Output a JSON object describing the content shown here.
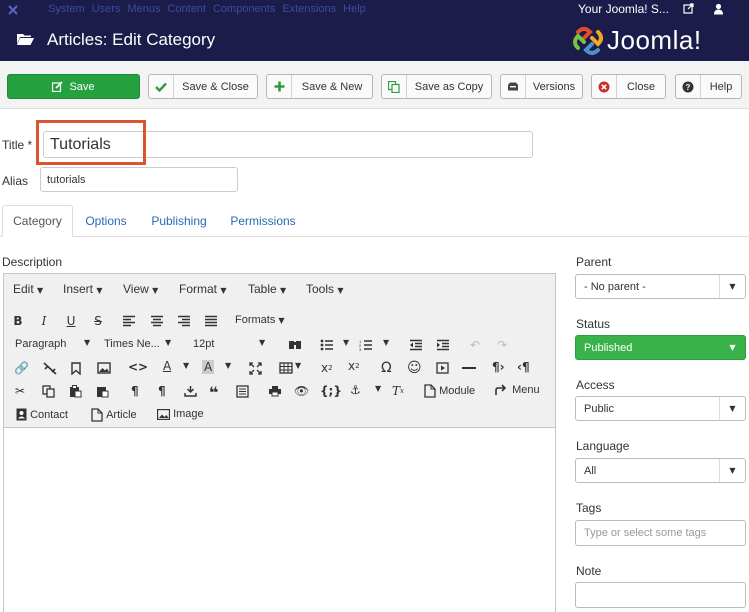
{
  "topnav": {
    "menu": [
      "System",
      "Users",
      "Menus",
      "Content",
      "Components",
      "Extensions",
      "Help"
    ],
    "site_name": "Your Joomla! S..."
  },
  "header": {
    "title": "Articles: Edit Category",
    "brand": "Joomla!"
  },
  "toolbar": {
    "save": "Save",
    "save_close": "Save & Close",
    "save_new": "Save & New",
    "save_copy": "Save as Copy",
    "versions": "Versions",
    "close": "Close",
    "help": "Help"
  },
  "form": {
    "title_label": "Title *",
    "title_value": "Tutorials",
    "alias_label": "Alias",
    "alias_value": "tutorials"
  },
  "tabs": [
    "Category",
    "Options",
    "Publishing",
    "Permissions"
  ],
  "editor": {
    "description_label": "Description",
    "menus": [
      "Edit",
      "Insert",
      "View",
      "Format",
      "Table",
      "Tools"
    ],
    "formats": "Formats",
    "paragraph": "Paragraph",
    "font": "Times Ne...",
    "size": "12pt",
    "module": "Module",
    "menu": "Menu",
    "contact": "Contact",
    "article": "Article",
    "image": "Image"
  },
  "sidebar": {
    "parent_label": "Parent",
    "parent_value": "- No parent -",
    "status_label": "Status",
    "status_value": "Published",
    "access_label": "Access",
    "access_value": "Public",
    "language_label": "Language",
    "language_value": "All",
    "tags_label": "Tags",
    "tags_placeholder": "Type or select some tags",
    "note_label": "Note"
  },
  "colors": {
    "nav_bg": "#1b1c4a",
    "save_green": "#25a140",
    "published_green": "#3ab24a",
    "highlight": "#d9552f",
    "link": "#2a69b8"
  }
}
